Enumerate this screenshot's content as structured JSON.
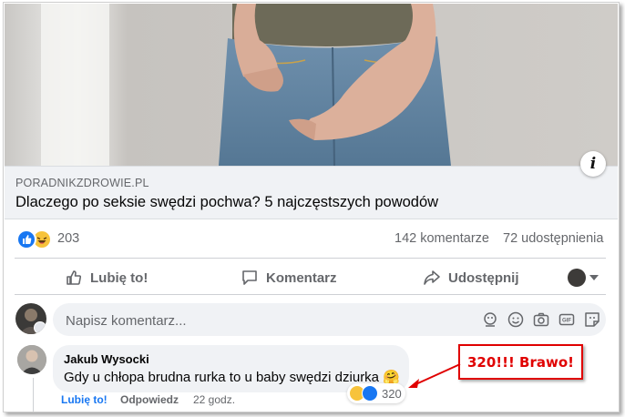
{
  "link_preview": {
    "domain": "PORADNIKZDROWIE.PL",
    "title": "Dlaczego po seksie swędzi pochwa? 5 najczęstszych powodów",
    "info_icon": "info-icon"
  },
  "post_stats": {
    "reaction_icons": [
      "like-reaction-icon",
      "haha-reaction-icon"
    ],
    "reaction_count": "203",
    "comments": "142 komentarze",
    "shares": "72 udostępnienia"
  },
  "actions": {
    "like": "Lubię to!",
    "comment": "Komentarz",
    "share": "Udostępnij"
  },
  "composer": {
    "placeholder": "Napisz komentarz...",
    "icons": [
      "avatar-sticker-icon",
      "emoji-icon",
      "camera-icon",
      "gif-icon",
      "sticker-icon"
    ]
  },
  "comment": {
    "author": "Jakub Wysocki",
    "text": "Gdy u chłopa brudna rurka to u baby swędzi dziurka 🤗",
    "like_label": "Lubię to!",
    "reply_label": "Odpowiedz",
    "time": "22 godz.",
    "reaction_count": "320"
  },
  "annotation": {
    "text": "320!!! Brawo!",
    "color": "#e00000"
  },
  "colors": {
    "facebook_blue": "#1877f2",
    "secondary_text": "#65676b",
    "input_bg": "#f0f2f5"
  }
}
